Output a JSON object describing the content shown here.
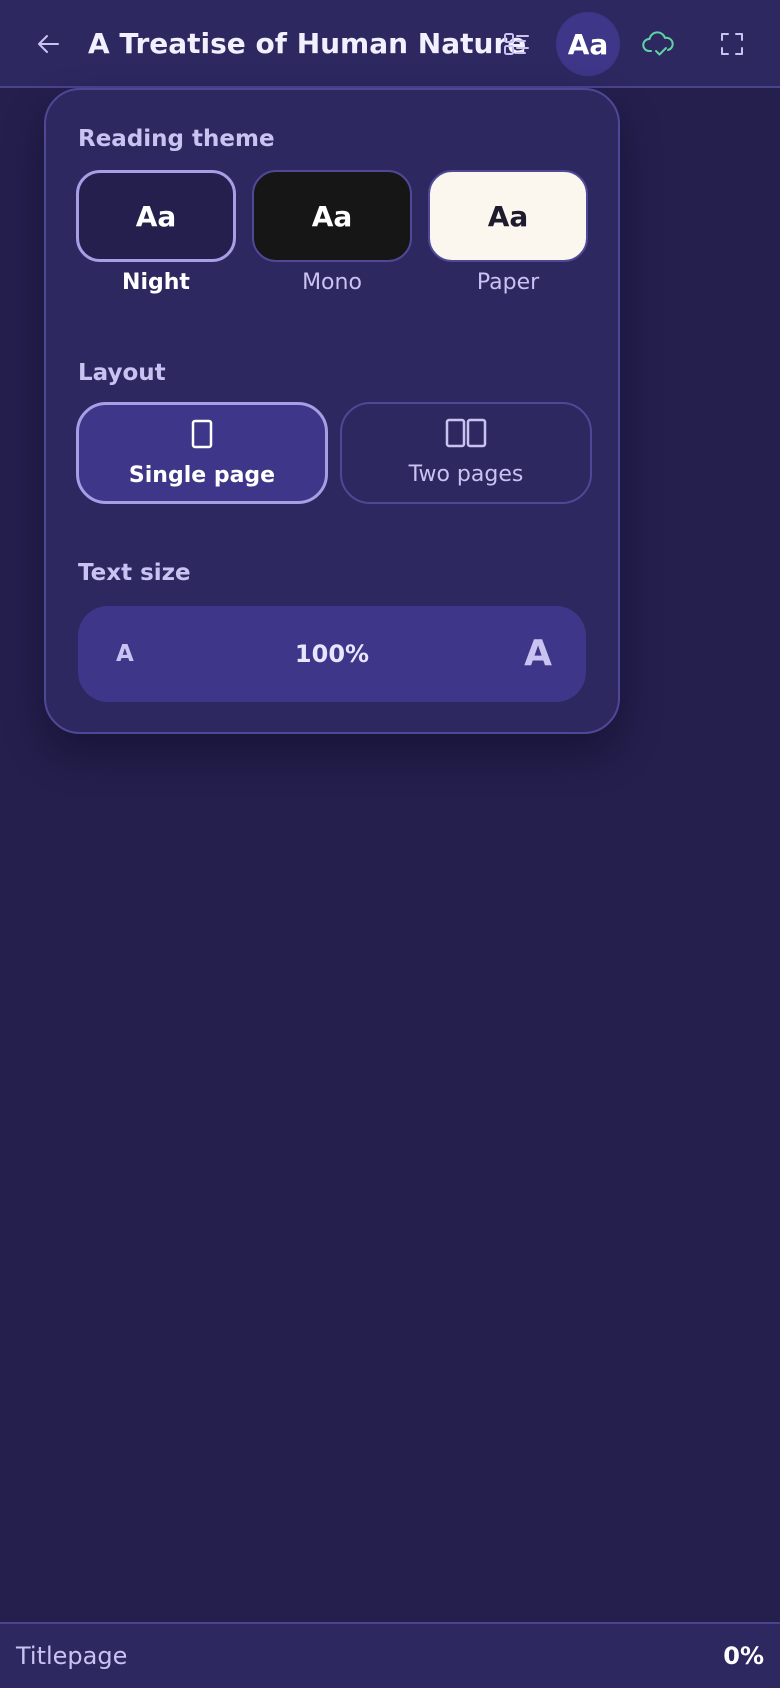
{
  "header": {
    "title": "A Treatise of Human Nature",
    "back_icon": "arrow-left-icon",
    "toc_icon": "table-of-contents-icon",
    "aa_label": "Aa",
    "sync_icon": "cloud-check-icon",
    "fullscreen_icon": "fullscreen-icon"
  },
  "settings": {
    "reading_theme": {
      "label": "Reading theme",
      "selected": "Night",
      "options": [
        {
          "name": "Night",
          "sample": "Aa",
          "background": "#241f4d",
          "text_color": "#ffffff"
        },
        {
          "name": "Mono",
          "sample": "Aa",
          "background": "#161616",
          "text_color": "#ffffff"
        },
        {
          "name": "Paper",
          "sample": "Aa",
          "background": "#fbf7ee",
          "text_color": "#1e1b2e"
        }
      ]
    },
    "layout": {
      "label": "Layout",
      "selected": "Single page",
      "options": [
        {
          "name": "Single page",
          "icon": "single-page-icon"
        },
        {
          "name": "Two pages",
          "icon": "two-pages-icon"
        }
      ]
    },
    "text_size": {
      "label": "Text size",
      "decrease_label": "A",
      "value": "100%",
      "increase_label": "A"
    }
  },
  "footer": {
    "chapter": "Titlepage",
    "progress": "0%"
  },
  "colors": {
    "background": "#241f4d",
    "surface": "#2d2860",
    "accent": "#3d3689",
    "accent_border": "#a79ee6",
    "muted_text": "#c9c3f2",
    "sync_green": "#5fd3a3"
  }
}
